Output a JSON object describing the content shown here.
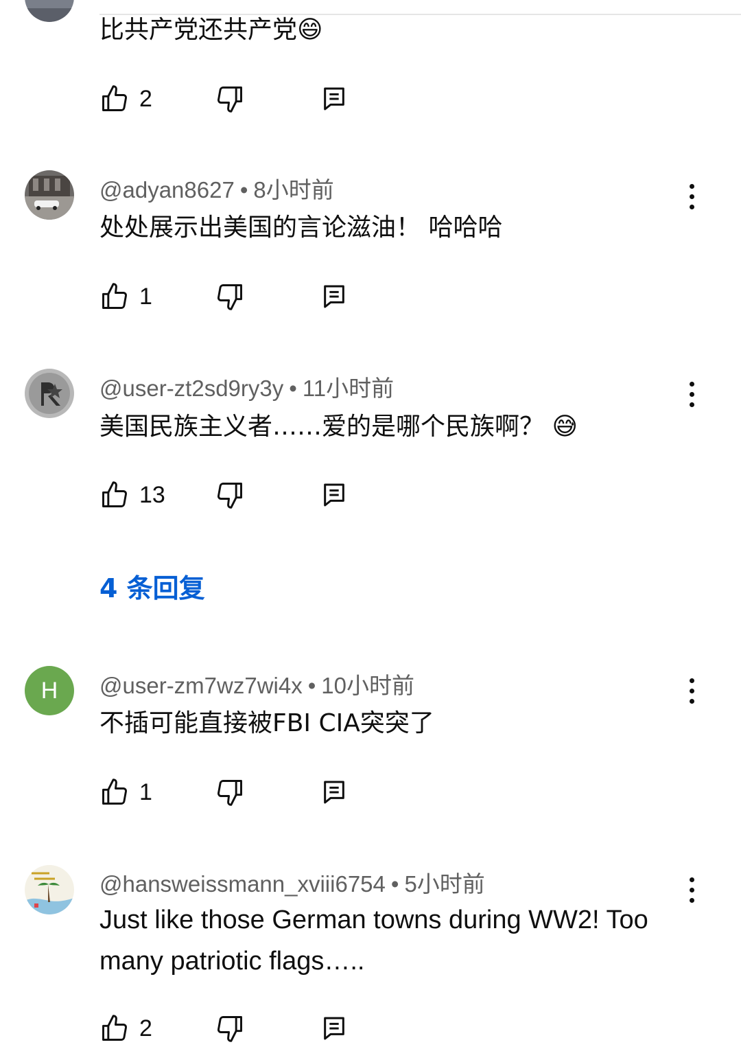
{
  "comments": [
    {
      "text": "比共产党还共产党😄",
      "likes": "2"
    },
    {
      "author": "@adyan8627",
      "time": "8小时前",
      "text": "处处展示出美国的言论滋油！ 哈哈哈",
      "likes": "1"
    },
    {
      "author": "@user-zt2sd9ry3y",
      "time": "11小时前",
      "text": "美国民族主义者……爱的是哪个民族啊？ 😅",
      "likes": "13",
      "replies_label": "4 条回复"
    },
    {
      "author": "@user-zm7wz7wi4x",
      "avatar_letter": "H",
      "avatar_color": "#6aa84f",
      "time": "10小时前",
      "text": "不插可能直接被FBI CIA突突了",
      "likes": "1"
    },
    {
      "author": "@hansweissmann_xviii6754",
      "time": "5小时前",
      "text": "Just like those German towns during WW2! Too many patriotic flags…..",
      "likes": "2"
    }
  ],
  "separator": "•",
  "colors": {
    "link": "#065fd4",
    "meta": "#606060",
    "text": "#0f0f0f"
  },
  "icons": [
    "like-icon",
    "dislike-icon",
    "reply-icon",
    "more-options-icon"
  ]
}
